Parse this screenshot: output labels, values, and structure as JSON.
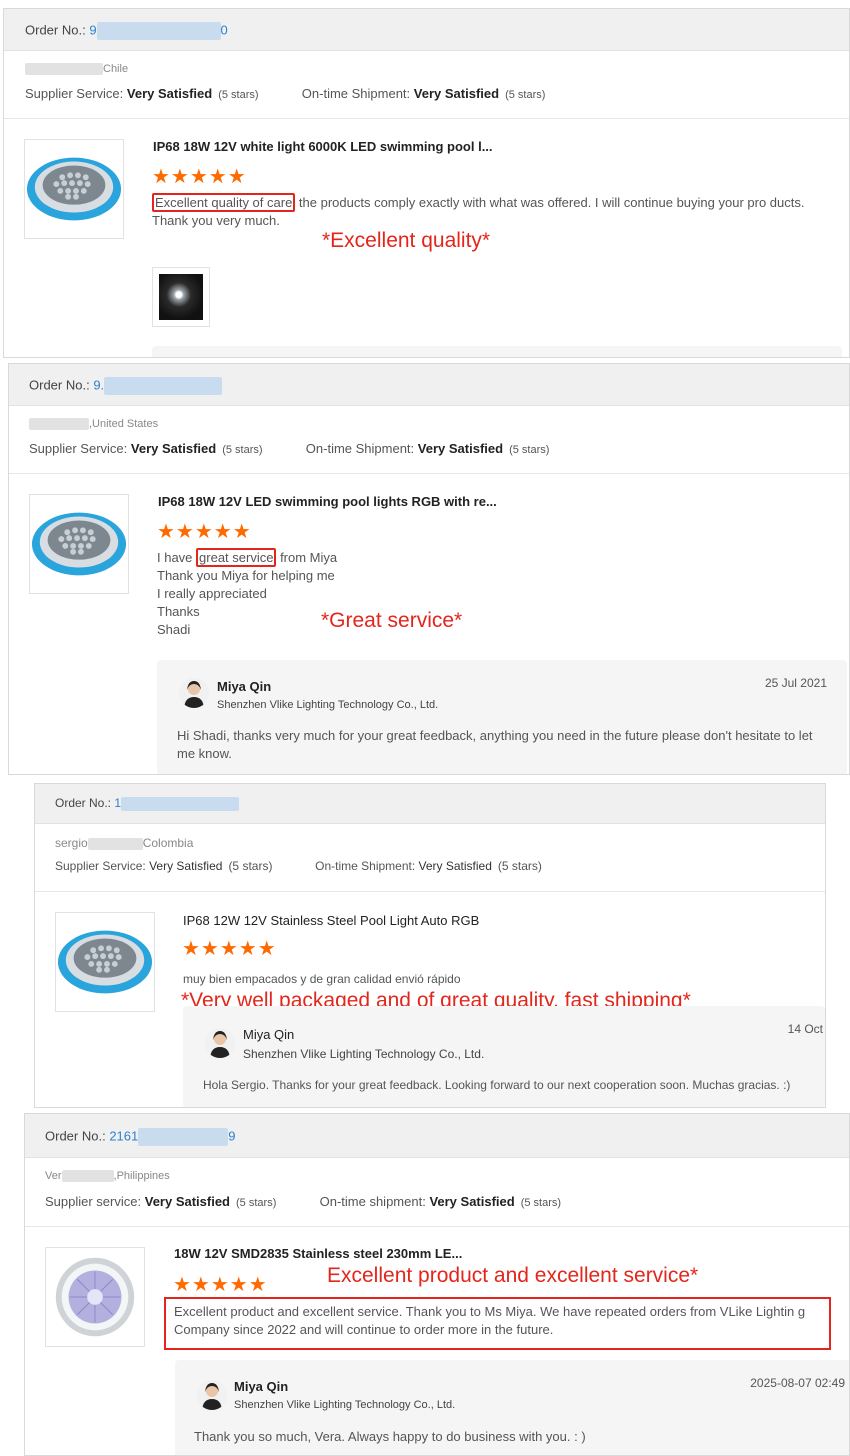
{
  "reviews": [
    {
      "order_label": "Order No.:",
      "order_start": "9",
      "order_end": "0",
      "country": "Chile",
      "supplier_label": "Supplier Service:",
      "supplier_value": "Very Satisfied",
      "supplier_stars": "(5 stars)",
      "shipment_label": "On-time Shipment:",
      "shipment_value": "Very Satisfied",
      "shipment_stars": "(5 stars)",
      "product_title": "IP68 18W 12V white light 6000K LED swimming pool l...",
      "stars": "★★★★★",
      "review_highlight": "Excellent quality of care",
      "review_rest": " the products comply exactly with what was offered. I will continue buying your pro ducts.",
      "review_line2": "Thank you very much.",
      "annotation": "*Excellent quality*"
    },
    {
      "order_label": "Order No.:",
      "order_start": "9.",
      "country": ",United States",
      "supplier_label": "Supplier Service:",
      "supplier_value": "Very Satisfied",
      "supplier_stars": "(5 stars)",
      "shipment_label": "On-time Shipment:",
      "shipment_value": "Very Satisfied",
      "shipment_stars": "(5 stars)",
      "product_title": "IP68 18W 12V LED swimming pool lights RGB with re...",
      "stars": "★★★★★",
      "review_pre": "I have ",
      "review_highlight": "great service",
      "review_post": " from Miya",
      "review_lines": [
        "Thank you Miya for helping me",
        "I really appreciated",
        "Thanks",
        "Shadi"
      ],
      "annotation": "*Great service*",
      "reply_name": "Miya Qin",
      "reply_company": "Shenzhen Vlike Lighting Technology Co., Ltd.",
      "reply_date": "25 Jul 2021",
      "reply_text": "Hi Shadi, thanks very much for your great feedback, anything you need in the future please don't hesitate to let me know."
    },
    {
      "order_label": "Order No.:",
      "order_start": "1",
      "name_prefix": "sergio",
      "country": "Colombia",
      "supplier_label": "Supplier Service:",
      "supplier_value": "Very Satisfied",
      "supplier_stars": "(5 stars)",
      "shipment_label": "On-time Shipment:",
      "shipment_value": "Very Satisfied",
      "shipment_stars": "(5 stars)",
      "product_title": "IP68 12W 12V Stainless Steel Pool Light Auto RGB",
      "stars": "★★★★★",
      "review_text": "muy bien empacados y de gran calidad envió rápido",
      "annotation": "*Very well packaged and of great quality, fast shipping*",
      "reply_name": "Miya Qin",
      "reply_company": "Shenzhen Vlike Lighting Technology Co., Ltd.",
      "reply_date": "14 Oct",
      "reply_text": "Hola Sergio. Thanks for your great feedback. Looking forward to our next cooperation soon.  Muchas gracias. :)"
    },
    {
      "order_label": "Order No.:",
      "order_start": "2161",
      "order_end": "9",
      "name_prefix": "Ver",
      "country": ",Philippines",
      "supplier_label": "Supplier service:",
      "supplier_value": "Very Satisfied",
      "supplier_stars": "(5 stars)",
      "shipment_label": "On-time shipment:",
      "shipment_value": "Very Satisfied",
      "shipment_stars": "(5 stars)",
      "product_title": "18W 12V SMD2835 Stainless steel 230mm LE...",
      "stars": "★★★★★",
      "annotation": "Excellent product and excellent service*",
      "review_text": "Excellent product and excellent service. Thank you to Ms Miya. We have repeated orders from VLike Lightin g Company since 2022 and will continue to order more in the future.",
      "reply_name": "Miya Qin",
      "reply_company": "Shenzhen Vlike Lighting Technology Co., Ltd.",
      "reply_date": "2025-08-07 02:49",
      "reply_text": "Thank you so much, Vera. Always happy to do business with you. : )"
    }
  ],
  "colors": {
    "accent_red": "#e3261c",
    "star_orange": "#ff6a00",
    "link_blue": "#2f7fcf"
  }
}
